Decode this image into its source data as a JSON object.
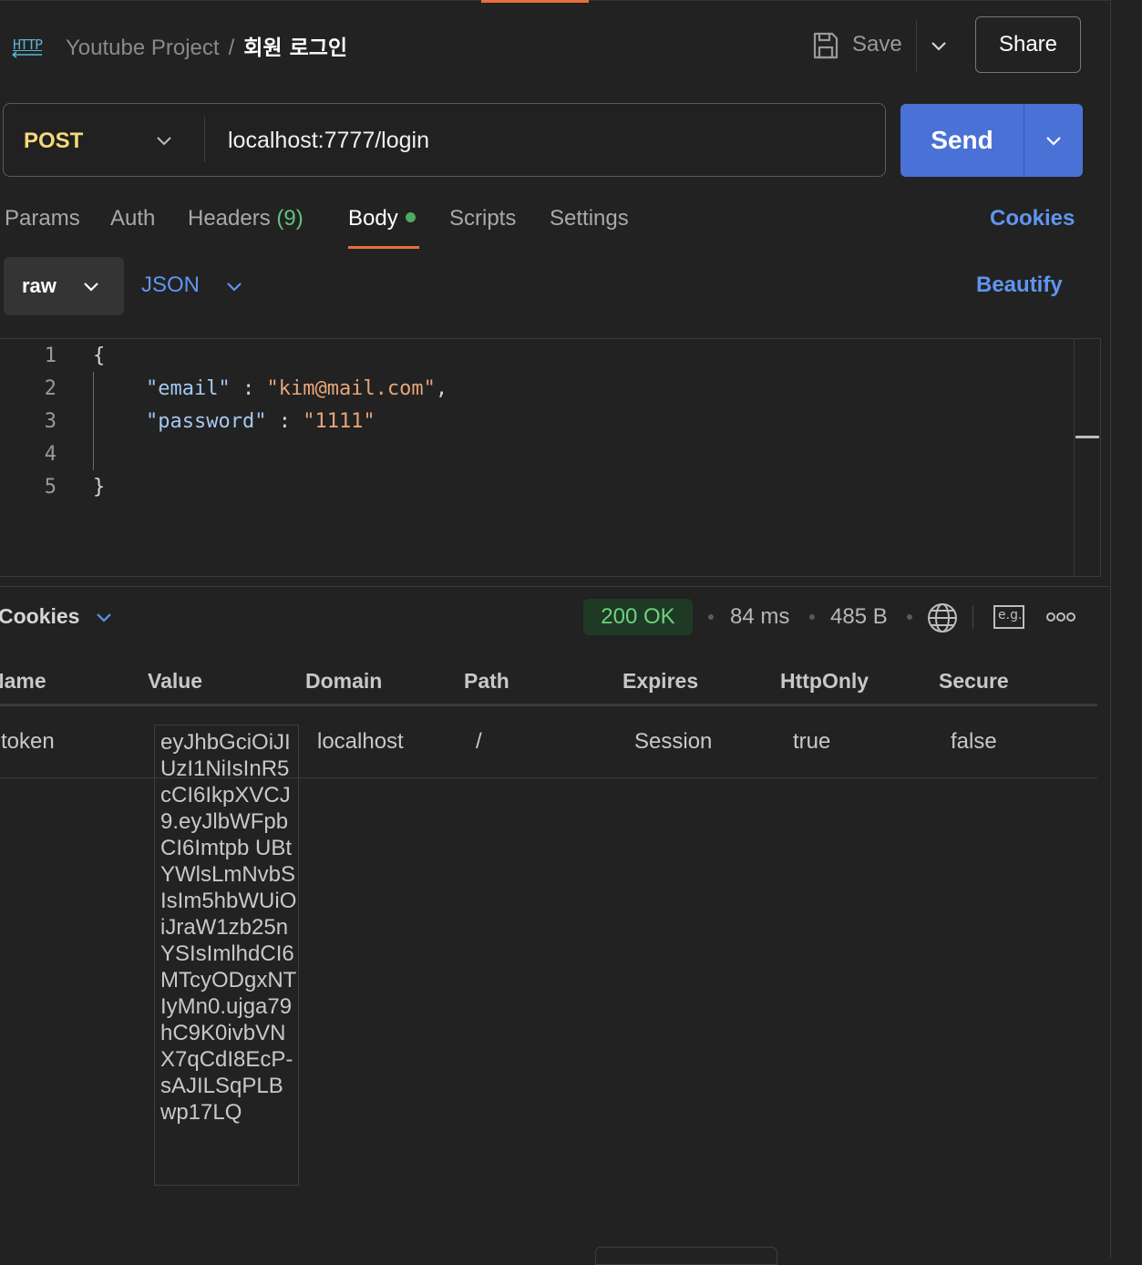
{
  "header": {
    "icon": "http-icon",
    "icon_text": "HTTP",
    "project": "Youtube Project",
    "separator": "/",
    "title": "회원 로그인",
    "save_label": "Save",
    "share_label": "Share"
  },
  "request": {
    "method": "POST",
    "url": "localhost:7777/login",
    "send_label": "Send"
  },
  "tabs": {
    "params": "Params",
    "auth": "Auth",
    "headers": "Headers",
    "headers_count": "(9)",
    "body": "Body",
    "scripts": "Scripts",
    "settings": "Settings",
    "cookies": "Cookies"
  },
  "body_toolbar": {
    "mode": "raw",
    "language": "JSON",
    "beautify": "Beautify"
  },
  "editor": {
    "line_numbers": [
      "1",
      "2",
      "3",
      "4",
      "5"
    ],
    "open_brace": "{",
    "close_brace": "}",
    "email_key": "\"email\"",
    "email_value": "\"kim@mail.com\"",
    "password_key": "\"password\"",
    "password_value": "\"1111\"",
    "colon": ":",
    "comma": ","
  },
  "response": {
    "tab": "Cookies",
    "status": "200 OK",
    "time": "84 ms",
    "size": "485 B",
    "eg_label": "e.g."
  },
  "cookies_table": {
    "columns": [
      "Name",
      "Value",
      "Domain",
      "Path",
      "Expires",
      "HttpOnly",
      "Secure"
    ],
    "rows": [
      {
        "name": "token",
        "value": "eyJhbGciOiJIUzI1NiIsInR5cCI6IkpXVCJ9.eyJlbWFpbCI6Imtpb UBtYWlsLmNvbSIsIm5hbWUiOiJraW1zb25nYSIsImlhdCI6MTcyODgxNTIyMn0.ujga79hC9K0ivbVNX7qCdI8EcP-sAJILSqPLBwp17LQ",
        "domain": "localhost",
        "path": "/",
        "expires": "Session",
        "httponly": "true",
        "secure": "false"
      }
    ]
  },
  "colors": {
    "accent": "#e8703a",
    "send": "#4a72d6",
    "link": "#5f95f0",
    "method": "#f5d97a",
    "status_ok": "#6dd27e"
  }
}
